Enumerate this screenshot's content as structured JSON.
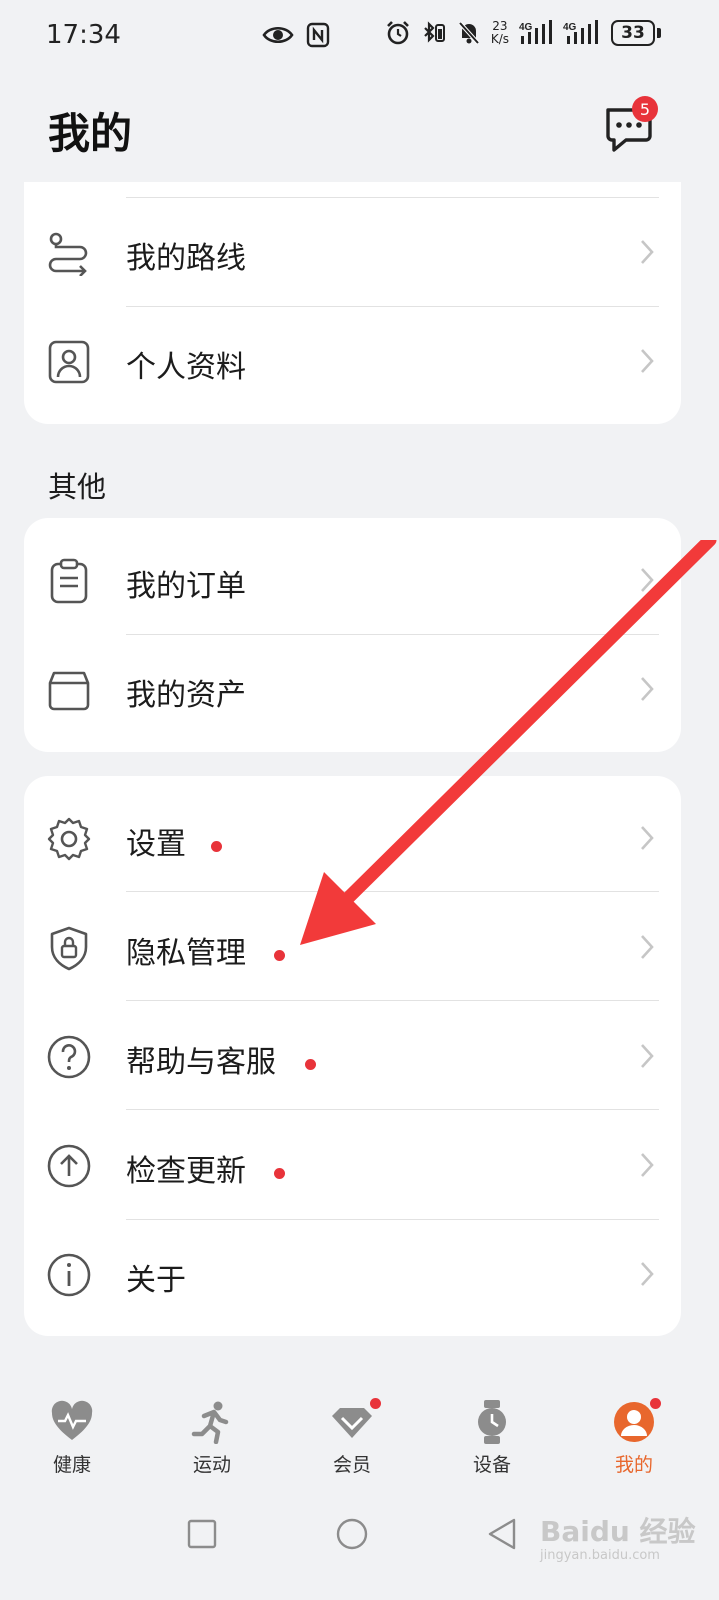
{
  "status_bar": {
    "time": "17:34",
    "speed_value": "23",
    "speed_unit": "K/s",
    "battery": "33",
    "icons": [
      "eye-icon",
      "nfc-icon",
      "alarm-icon",
      "bluetooth-icon",
      "mute-icon",
      "signal-4g-icon",
      "signal-4g-icon",
      "battery-icon"
    ]
  },
  "header": {
    "title": "我的",
    "message_badge": "5"
  },
  "top_card": {
    "items": [
      {
        "label": "我的路线",
        "icon": "route-icon"
      },
      {
        "label": "个人资料",
        "icon": "profile-icon"
      }
    ]
  },
  "other_section": {
    "title": "其他",
    "items": [
      {
        "label": "我的订单",
        "icon": "clipboard-icon"
      },
      {
        "label": "我的资产",
        "icon": "box-icon"
      }
    ]
  },
  "settings_card": {
    "items": [
      {
        "label": "设置",
        "icon": "gear-icon",
        "has_dot": true
      },
      {
        "label": "隐私管理",
        "icon": "shield-lock-icon",
        "has_dot": true
      },
      {
        "label": "帮助与客服",
        "icon": "help-icon",
        "has_dot": true
      },
      {
        "label": "检查更新",
        "icon": "upload-icon",
        "has_dot": true
      },
      {
        "label": "关于",
        "icon": "info-icon",
        "has_dot": false
      }
    ]
  },
  "bottom_nav": {
    "items": [
      {
        "label": "健康",
        "icon": "heart-pulse-icon",
        "active": false,
        "dot": false
      },
      {
        "label": "运动",
        "icon": "running-icon",
        "active": false,
        "dot": false
      },
      {
        "label": "会员",
        "icon": "diamond-icon",
        "active": false,
        "dot": true
      },
      {
        "label": "设备",
        "icon": "watch-icon",
        "active": false,
        "dot": false
      },
      {
        "label": "我的",
        "icon": "avatar-icon",
        "active": true,
        "dot": true
      }
    ]
  },
  "watermark": {
    "text": "Baidu 经验",
    "sub": "jingyan.baidu.com"
  },
  "colors": {
    "background": "#f1f2f4",
    "card": "#ffffff",
    "badge_red": "#e8333a",
    "active_orange": "#e8672d",
    "annotation_arrow": "#f23a3a"
  }
}
